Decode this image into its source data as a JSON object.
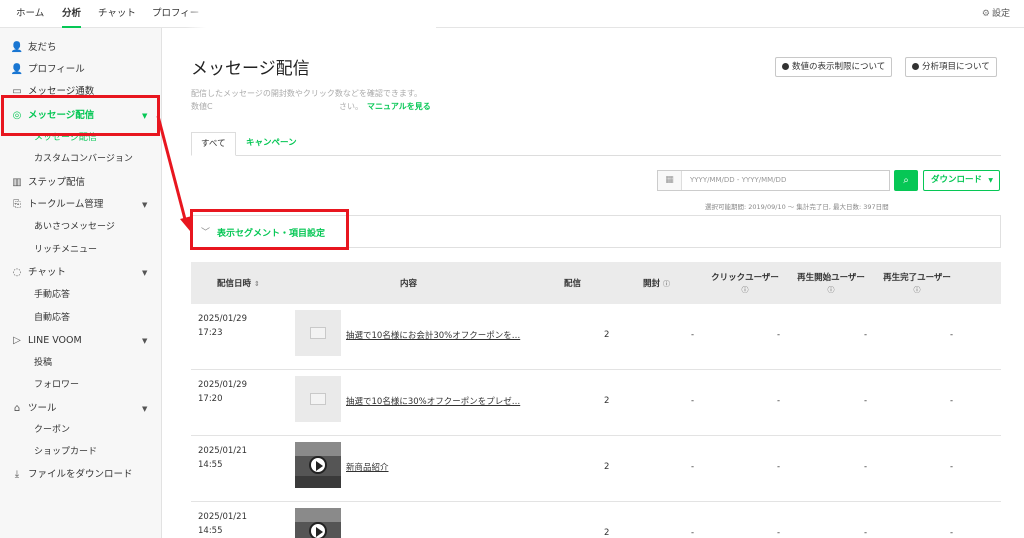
{
  "topnav": {
    "tabs": [
      "ホーム",
      "分析",
      "チャット",
      "プロフィー"
    ],
    "active_index": 1,
    "settings_label": "設定"
  },
  "sidebar": {
    "items": [
      {
        "label": "友だち",
        "icon": "friends-icon"
      },
      {
        "label": "プロフィール",
        "icon": "profile-icon"
      },
      {
        "label": "メッセージ通数",
        "icon": "message-count-icon"
      },
      {
        "label": "メッセージ配信",
        "icon": "broadcast-icon",
        "active": true
      },
      {
        "label": "ステップ配信",
        "icon": "step-icon"
      },
      {
        "label": "トークルーム管理",
        "icon": "talkroom-icon"
      },
      {
        "label": "チャット",
        "icon": "chat-icon"
      },
      {
        "label": "LINE VOOM",
        "icon": "voom-icon"
      },
      {
        "label": "ツール",
        "icon": "store-icon"
      },
      {
        "label": "ファイルをダウンロード",
        "icon": "download-icon"
      }
    ],
    "sub": {
      "broadcast": [
        "メッセージ配信",
        "カスタムコンバージョン"
      ],
      "talkroom": [
        "あいさつメッセージ",
        "リッチメニュー"
      ],
      "chat": [
        "手動応答",
        "自動応答"
      ],
      "voom": [
        "投稿",
        "フォロワー"
      ],
      "tools": [
        "クーポン",
        "ショップカード"
      ]
    }
  },
  "main": {
    "title": "メッセージ配信",
    "buttons": {
      "limit": "数値の表示制限について",
      "items": "分析項目について"
    },
    "desc_line1": "配信したメッセージの開封数やクリック数などを確認できます。",
    "desc_line2_start": "数値C",
    "desc_line2_end": "さい。",
    "manual_link": "マニュアルを見る",
    "tabs": [
      "すべて",
      "キャンペーン"
    ],
    "date_placeholder": "YYYY/MM/DD  -  YYYY/MM/DD",
    "download_label": "ダウンロード",
    "period_note": "選択可能期間: 2019/09/10 〜 集計完了日, 最大日数: 397日間",
    "segment_label": "表示セグメント・項目設定"
  },
  "table": {
    "headers": {
      "date": "配信日時",
      "content": "内容",
      "delivered": "配信",
      "opened": "開封",
      "click_users": "クリックユーザー",
      "play_start_users": "再生開始ユーザー",
      "play_complete_users": "再生完了ユーザー"
    },
    "rows": [
      {
        "date": "2025/01/29",
        "time": "17:23",
        "title": "抽選で10名様にお会計30%オフクーポンを…",
        "delivered": "2",
        "opened": "-",
        "click": "-",
        "play_start": "-",
        "play_complete": "-",
        "thumb": "image"
      },
      {
        "date": "2025/01/29",
        "time": "17:20",
        "title": "抽選で10名様に30%オフクーポンをプレゼ…",
        "delivered": "2",
        "opened": "-",
        "click": "-",
        "play_start": "-",
        "play_complete": "-",
        "thumb": "image"
      },
      {
        "date": "2025/01/21",
        "time": "14:55",
        "title": "新商品紹介",
        "delivered": "2",
        "opened": "-",
        "click": "-",
        "play_start": "-",
        "play_complete": "-",
        "thumb": "video"
      },
      {
        "date": "2025/01/21",
        "time": "14:55",
        "title": "",
        "delivered": "2",
        "opened": "-",
        "click": "-",
        "play_start": "-",
        "play_complete": "-",
        "thumb": "video"
      }
    ]
  },
  "colors": {
    "accent": "#06c755",
    "annotation": "#e8161f"
  }
}
